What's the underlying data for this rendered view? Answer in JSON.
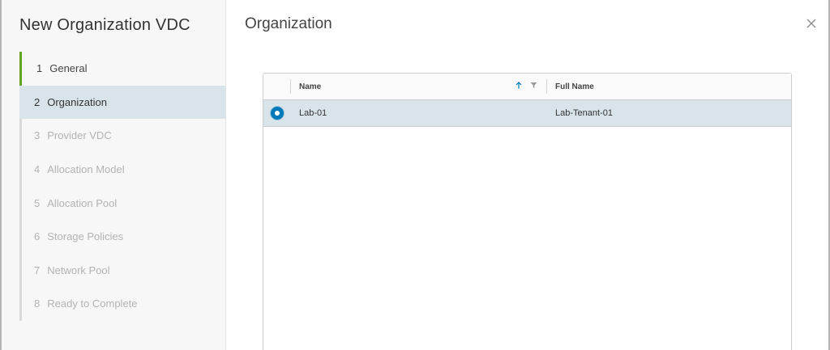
{
  "wizard": {
    "title": "New Organization VDC",
    "steps": [
      {
        "num": "1",
        "label": "General",
        "state": "done"
      },
      {
        "num": "2",
        "label": "Organization",
        "state": "active"
      },
      {
        "num": "3",
        "label": "Provider VDC",
        "state": "disabled"
      },
      {
        "num": "4",
        "label": "Allocation Model",
        "state": "disabled"
      },
      {
        "num": "5",
        "label": "Allocation Pool",
        "state": "disabled"
      },
      {
        "num": "6",
        "label": "Storage Policies",
        "state": "disabled"
      },
      {
        "num": "7",
        "label": "Network Pool",
        "state": "disabled"
      },
      {
        "num": "8",
        "label": "Ready to Complete",
        "state": "disabled"
      }
    ]
  },
  "page": {
    "title": "Organization",
    "close_icon": "close-icon"
  },
  "grid": {
    "columns": {
      "name": "Name",
      "full_name": "Full Name"
    },
    "sort_icon": "arrow-up-icon",
    "filter_icon": "filter-icon",
    "rows": [
      {
        "name": "Lab-01",
        "full_name": "Lab-Tenant-01",
        "selected": true
      }
    ]
  },
  "colors": {
    "accent": "#0079b8",
    "done_step": "#62a420",
    "selected_row": "#d9e4ea"
  }
}
